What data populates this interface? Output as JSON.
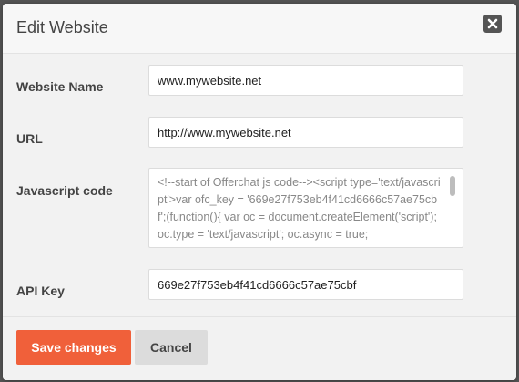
{
  "modal": {
    "title": "Edit Website",
    "close_icon": "close-icon"
  },
  "form": {
    "website_name": {
      "label": "Website Name",
      "value": "www.mywebsite.net"
    },
    "url": {
      "label": "URL",
      "value": "http://www.mywebsite.net"
    },
    "javascript_code": {
      "label": "Javascript code",
      "value": "<!--start of Offerchat js code--><script type='text/javascript'>var ofc_key = '669e27f753eb4f41cd6666c57ae75cbf';(function(){  var oc = document.createElement('script'); oc.type = 'text/javascript'; oc.async = true;"
    },
    "api_key": {
      "label": "API Key",
      "value": "669e27f753eb4f41cd6666c57ae75cbf"
    }
  },
  "footer": {
    "save_label": "Save changes",
    "cancel_label": "Cancel"
  },
  "colors": {
    "primary_button": "#f0603a",
    "secondary_button": "#dcdcdc",
    "close_button": "#555555"
  }
}
